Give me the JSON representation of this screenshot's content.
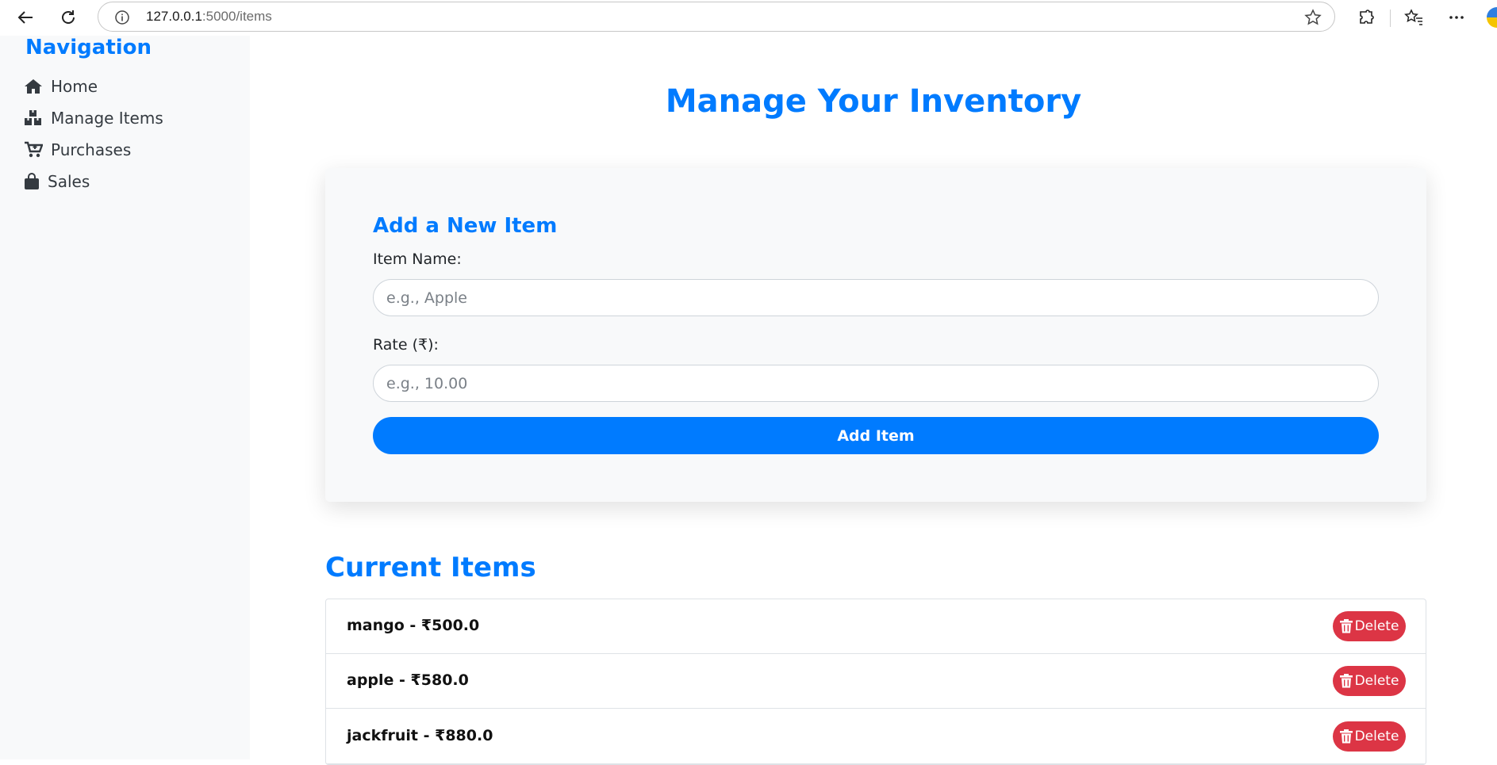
{
  "browser": {
    "url_host": "127.0.0.1",
    "url_path": ":5000/items",
    "icons": [
      "back-icon",
      "reload-icon",
      "info-icon",
      "star-icon",
      "extensions-icon",
      "favorites-icon",
      "more-icon"
    ]
  },
  "sidebar": {
    "title": "Navigation",
    "items": [
      {
        "label": "Home",
        "icon": "home-icon"
      },
      {
        "label": "Manage Items",
        "icon": "boxes-icon"
      },
      {
        "label": "Purchases",
        "icon": "cart-icon"
      },
      {
        "label": "Sales",
        "icon": "shopping-bag-icon"
      }
    ]
  },
  "main": {
    "title": "Manage Your Inventory",
    "form": {
      "title": "Add a New Item",
      "name_label": "Item Name:",
      "name_placeholder": "e.g., Apple",
      "rate_label": "Rate (₹):",
      "rate_placeholder": "e.g., 10.00",
      "submit_label": "Add Item"
    },
    "list_title": "Current Items",
    "items": [
      {
        "text": "mango - ₹500.0",
        "delete_label": "Delete"
      },
      {
        "text": "apple - ₹580.0",
        "delete_label": "Delete"
      },
      {
        "text": "jackfruit - ₹880.0",
        "delete_label": "Delete"
      }
    ]
  },
  "colors": {
    "primary": "#007bff",
    "danger": "#dc3545",
    "sidebar_bg": "#f8f9fa"
  }
}
